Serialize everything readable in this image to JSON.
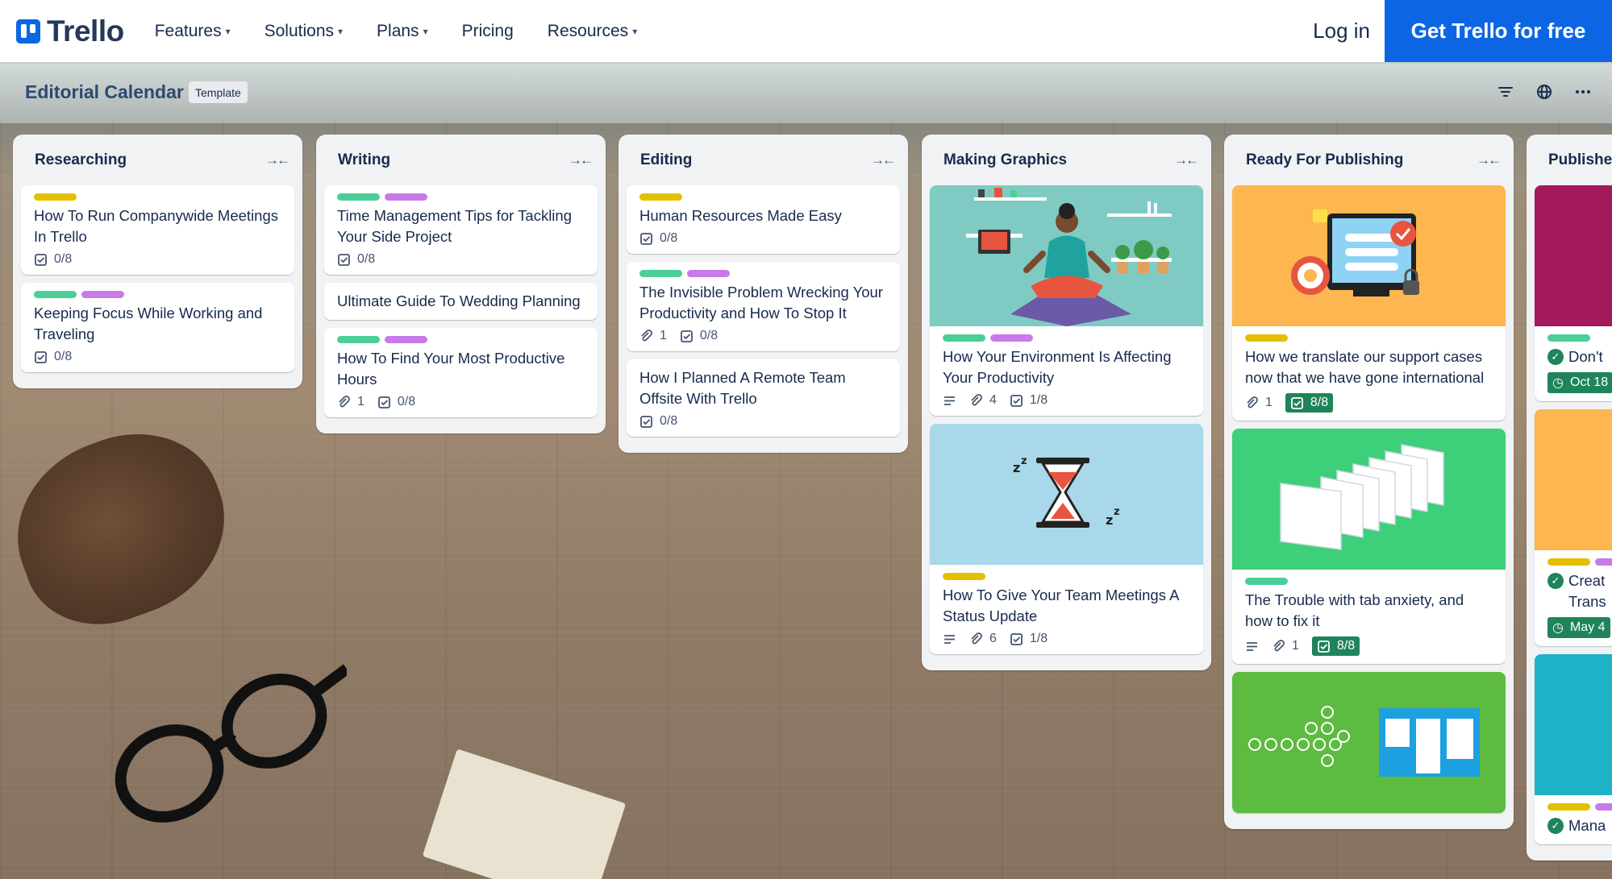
{
  "nav": {
    "logo_text": "Trello",
    "items": [
      {
        "label": "Features"
      },
      {
        "label": "Solutions"
      },
      {
        "label": "Plans"
      },
      {
        "label": "Pricing"
      },
      {
        "label": "Resources"
      }
    ],
    "login": "Log in",
    "cta": "Get Trello for free"
  },
  "board": {
    "title": "Editorial Calendar",
    "badge": "Template"
  },
  "lists": [
    {
      "title": "Researching",
      "cards": [
        {
          "title": "How To Run Companywide Meetings In Trello",
          "checklist": "0/8"
        },
        {
          "title": "Keeping Focus While Working and Traveling",
          "checklist": "0/8"
        }
      ]
    },
    {
      "title": "Writing",
      "cards": [
        {
          "title": "Time Management Tips for Tackling Your Side Project",
          "checklist": "0/8"
        },
        {
          "title": "Ultimate Guide To Wedding Planning"
        },
        {
          "title": "How To Find Your Most Productive Hours",
          "attachments": "1",
          "checklist": "0/8"
        }
      ]
    },
    {
      "title": "Editing",
      "cards": [
        {
          "title": "Human Resources Made Easy",
          "checklist": "0/8"
        },
        {
          "title": "The Invisible Problem Wrecking Your Productivity and How To Stop It",
          "attachments": "1",
          "checklist": "0/8"
        },
        {
          "title": "How I Planned A Remote Team Offsite With Trello",
          "checklist": "0/8"
        }
      ]
    },
    {
      "title": "Making Graphics",
      "cards": [
        {
          "title": "How Your Environment Is Affecting Your Productivity",
          "attachments": "4",
          "checklist": "1/8"
        },
        {
          "title": "How To Give Your Team Meetings A Status Update",
          "attachments": "6",
          "checklist": "1/8"
        }
      ]
    },
    {
      "title": "Ready For Publishing",
      "cards": [
        {
          "title": "How we translate our support cases now that we have gone international",
          "attachments": "1",
          "checklist": "8/8"
        },
        {
          "title": "The Trouble with tab anxiety, and how to fix it",
          "attachments": "1",
          "checklist": "8/8"
        }
      ]
    },
    {
      "title": "Publishe",
      "cards": [
        {
          "title": "Don't",
          "date": "Oct 18"
        },
        {
          "title": "Creat",
          "title2": "Trans",
          "date": "May 4"
        },
        {
          "title": "Mana"
        }
      ]
    }
  ],
  "colors": {
    "brand_blue": "#0c66e4",
    "label_yellow": "#e2c000",
    "label_green": "#4bce97",
    "label_purple": "#c77ae8",
    "done_green": "#1f845a"
  }
}
